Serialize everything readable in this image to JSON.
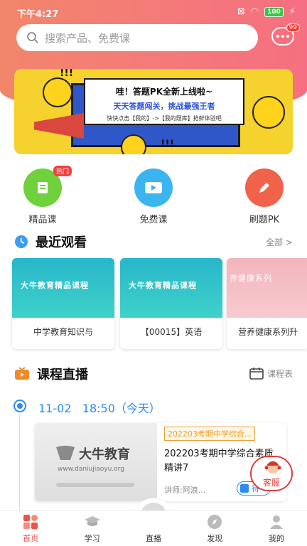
{
  "status": {
    "time": "下午4:27",
    "battery": "100"
  },
  "search": {
    "placeholder": "搜索产品、免费课"
  },
  "messages": {
    "badge": "99"
  },
  "banner": {
    "line1": "哇！答题PK全新上线啦~",
    "line2": "天天答题闯关，挑战最强王者",
    "line3": "快快点击【我的】->【我的题库】抢鲜体验吧",
    "bang": "!!!"
  },
  "quick_links": [
    {
      "label": "精品课",
      "badge": "热门",
      "color": "#6fd13b"
    },
    {
      "label": "免费课",
      "color": "#3bb5f0"
    },
    {
      "label": "刷题PK",
      "color": "#f0634a"
    }
  ],
  "recent": {
    "title": "最近观看",
    "more": "全部 >",
    "items": [
      {
        "thumb_title": "大牛教育精品课程",
        "caption": "中学教育知识与"
      },
      {
        "thumb_title": "大牛教育精品课程",
        "caption": "【00015】英语"
      },
      {
        "thumb_title": "养健康系列",
        "caption": "营养健康系列升"
      }
    ]
  },
  "live": {
    "title": "课程直播",
    "schedule": "课程表",
    "date": "11-02",
    "time": "18:50（今天）",
    "card": {
      "brand": "大牛教育",
      "brand_url": "www.daniujiaoyu.org",
      "tag": "202203考期中学综合...",
      "title": "202203考期中学综合素质精讲7",
      "teacher": "讲师:阿浪..."
    },
    "service": "客服",
    "watch_btn": "待"
  },
  "tabs": [
    {
      "label": "首页",
      "active": true
    },
    {
      "label": "学习"
    },
    {
      "label": "直播"
    },
    {
      "label": "发现"
    },
    {
      "label": "我的"
    }
  ],
  "colors": {
    "accent": "#f0524a",
    "live_blue": "#2a8cf0",
    "header_gradient_start": "#f2866a",
    "header_gradient_end": "#f56f80"
  }
}
